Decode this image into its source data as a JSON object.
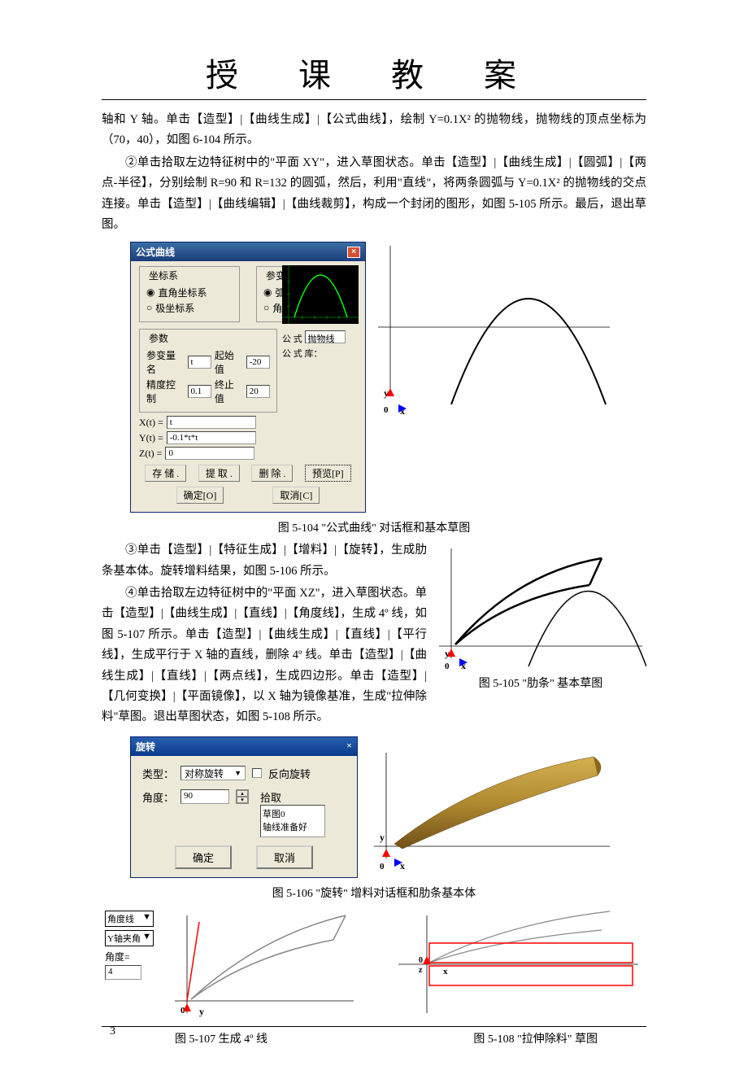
{
  "header": {
    "title": "授 课 教 案"
  },
  "body": {
    "p1": "轴和 Y 轴。单击【造型】|【曲线生成】|【公式曲线】，绘制 Y=0.1X² 的抛物线，抛物线的顶点坐标为（70，40），如图 6-104 所示。",
    "p2": "②单击拾取左边特征树中的\"平面 XY\"，进入草图状态。单击【造型】|【曲线生成】|【圆弧】|【两点-半径】，分别绘制 R=90 和 R=132 的圆弧，然后，利用\"直线\"，将两条圆弧与 Y=0.1X² 的抛物线的交点连接。单击【造型】|【曲线编辑】|【曲线裁剪】，构成一个封闭的图形，如图 5-105 所示。最后，退出草图。",
    "caption1": "图 5-104 \"公式曲线\" 对话框和基本草图",
    "p3": "③单击【造型】|【特征生成】|【增料】|【旋转】，生成肋条基本体。旋转增料结果，如图 5-106 所示。",
    "p4": "④单击拾取左边特征树中的\"平面 XZ\"，进入草图状态。单击【造型】|【曲线生成】|【直线】|【角度线】，生成 4º 线，如图 5-107 所示。单击【造型】|【曲线生成】|【直线】|【平行线】，生成平行于 X 轴的直线，删除 4º 线。单击【造型】|【曲线生成】|【直线】|【两点线】，生成四边形。单击【造型】|【几何变换】|【平面镜像】，以 X 轴为镜像基准，生成\"拉伸除料\"草图。退出草图状态，如图 5-108 所示。",
    "caption_side": "图 5-105 \"肋条\" 基本草图",
    "caption2": "图 5-106 \"旋转\" 增料对话框和肋条基本体",
    "caption3_left": "图 5-107  生成 4º 线",
    "caption3_right": "图 5-108 \"拉伸除料\" 草图"
  },
  "dialog1": {
    "title": "公式曲线",
    "grp_coord": "坐标系",
    "radio_rect": "直角坐标系",
    "radio_polar": "极坐标系",
    "grp_unit": "参变量单位",
    "radio_rad": "弧度",
    "radio_deg": "角度",
    "grp_param": "参数",
    "var_name_label": "参变量名",
    "var_name_val": "t",
    "start_label": "起始值",
    "start_val": "-20",
    "prec_label": "精度控制",
    "prec_val": "0.1",
    "end_label": "终止值",
    "end_val": "20",
    "xt_label": "X(t) =",
    "xt_val": "t",
    "yt_label": "Y(t) =",
    "yt_val": "-0.1*t*t",
    "zt_label": "Z(t) =",
    "zt_val": "0",
    "right_label1": "公  式",
    "right_val1": "抛物线",
    "right_label2": "公 式 库：",
    "btn_save": "存 储 .",
    "btn_get": "提 取 .",
    "btn_del": "删 除 .",
    "btn_preview": "预览[P]",
    "btn_ok": "确定[O]",
    "btn_cancel": "取消[C]"
  },
  "axis1": {
    "y": "y",
    "o": "0",
    "x": "x"
  },
  "dialog2": {
    "title": "旋转",
    "type_label": "类型：",
    "type_val": "对称旋转",
    "reverse": "反向旋转",
    "angle_label": "角度：",
    "angle_val": "90",
    "pick_label": "拾取",
    "list1": "草图0",
    "list2": "轴线准备好",
    "btn_ok": "确定",
    "btn_cancel": "取消"
  },
  "axis2": {
    "y": "y",
    "o": "0",
    "x": "x"
  },
  "bottom": {
    "combo1": "角度线",
    "combo2": "Y轴夹角",
    "angle_label": "角度=",
    "angle_val": "4",
    "y": "y",
    "o": "0",
    "oz": "0",
    "z": "z",
    "x": "x"
  },
  "page_num": "3"
}
